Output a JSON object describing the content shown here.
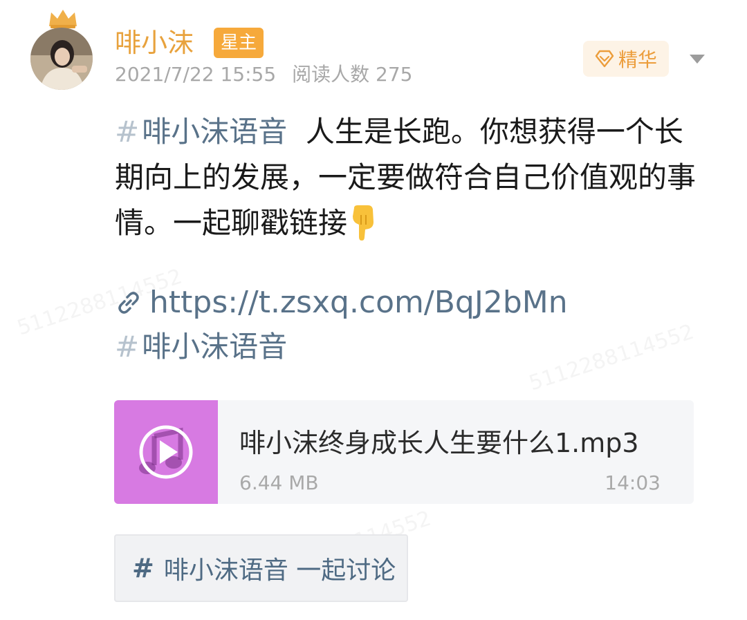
{
  "post": {
    "author": {
      "name": "啡小沫",
      "badge": "星主",
      "avatar_icon": "avatar-photo"
    },
    "meta": {
      "date": "2021/7/22 15:55",
      "reads_label": "阅读人数",
      "reads_count": "275"
    },
    "essence_label": "精华",
    "body": {
      "topic": "啡小沫语音",
      "text": "人生是长跑。你想获得一个长期向上的发展，一定要做符合自己价值观的事情。一起聊戳链接"
    },
    "link": "https://t.zsxq.com/BqJ2bMn",
    "topic_tag": "啡小沫语音",
    "audio": {
      "title": "啡小沫终身成长人生要什么1.mp3",
      "size": "6.44 MB",
      "duration": "14:03",
      "thumb_color": "#d77ae2"
    },
    "discuss_chip": "啡小沫语音 一起讨论"
  },
  "colors": {
    "author": "#e8a23d",
    "badge_bg": "#f6a93b",
    "essence": "#ec9d3b",
    "topic": "#597289",
    "text": "#1a1a1a",
    "meta": "#a8a8a8"
  }
}
